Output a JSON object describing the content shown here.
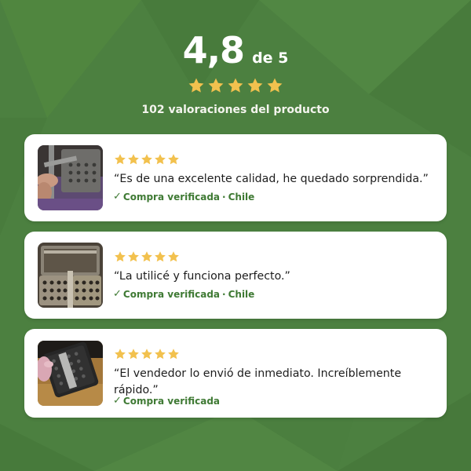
{
  "summary": {
    "rating": "4,8",
    "rating_scale": "de 5",
    "stars_filled": 5,
    "count_text": "102 valoraciones del producto"
  },
  "colors": {
    "background": "#4c8040",
    "star": "#f2c14e",
    "verified_text": "#3f7a34"
  },
  "reviews": [
    {
      "stars": 5,
      "quote": "“Es de una excelente calidad, he quedado sorprendida.”",
      "verified_label": "Compra verificada",
      "separator": "·",
      "country": "Chile",
      "photo": "hand holding metal waffle mold tool"
    },
    {
      "stars": 5,
      "quote": "“La utilicé y funciona perfecto.”",
      "verified_label": "Compra verificada",
      "separator": "·",
      "country": "Chile",
      "photo": "open metal waffle iron with spiked plates"
    },
    {
      "stars": 5,
      "quote": "“El vendedor lo envió de inmediato. Increíblemente rápido.”",
      "verified_label": "Compra verificada",
      "photo": "hand holding black waffle mold with spikes"
    }
  ]
}
